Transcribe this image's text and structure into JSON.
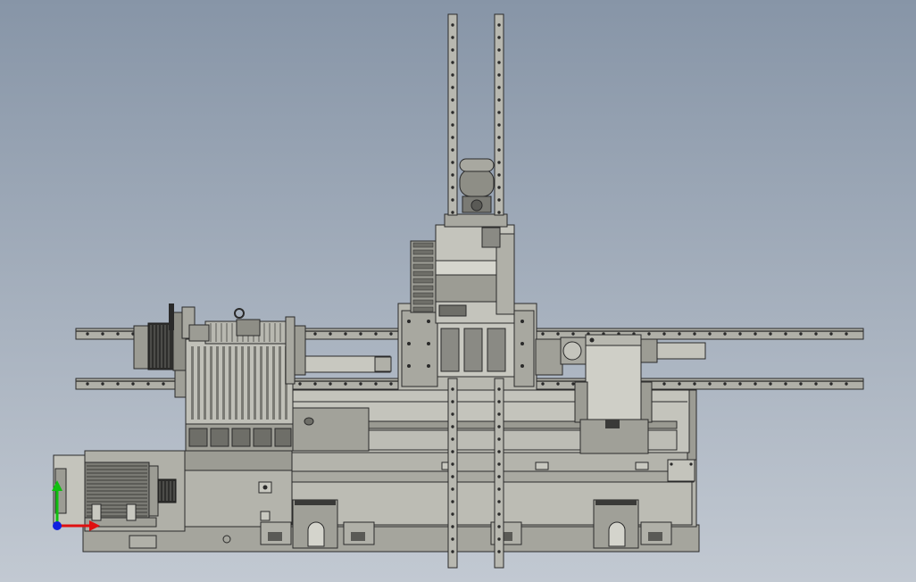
{
  "scene": {
    "background_top": "#8795a7",
    "background_bottom": "#c2c9d2",
    "metal_light": "#b8b8b0",
    "metal_mid": "#9c9c94",
    "metal_dark": "#6e6e68",
    "edge": "#2a2a2a"
  },
  "triad": {
    "x_axis_color": "#e01010",
    "y_axis_color": "#10c010",
    "z_axis_color": "#1020e0"
  },
  "parts": [
    "vertical-column-rail-left",
    "vertical-column-rail-right",
    "upper-linear-rail",
    "lower-linear-rail",
    "spindle-headstock",
    "main-motor",
    "turret-slide",
    "servo-motor",
    "tailstock",
    "machine-bed-base"
  ]
}
